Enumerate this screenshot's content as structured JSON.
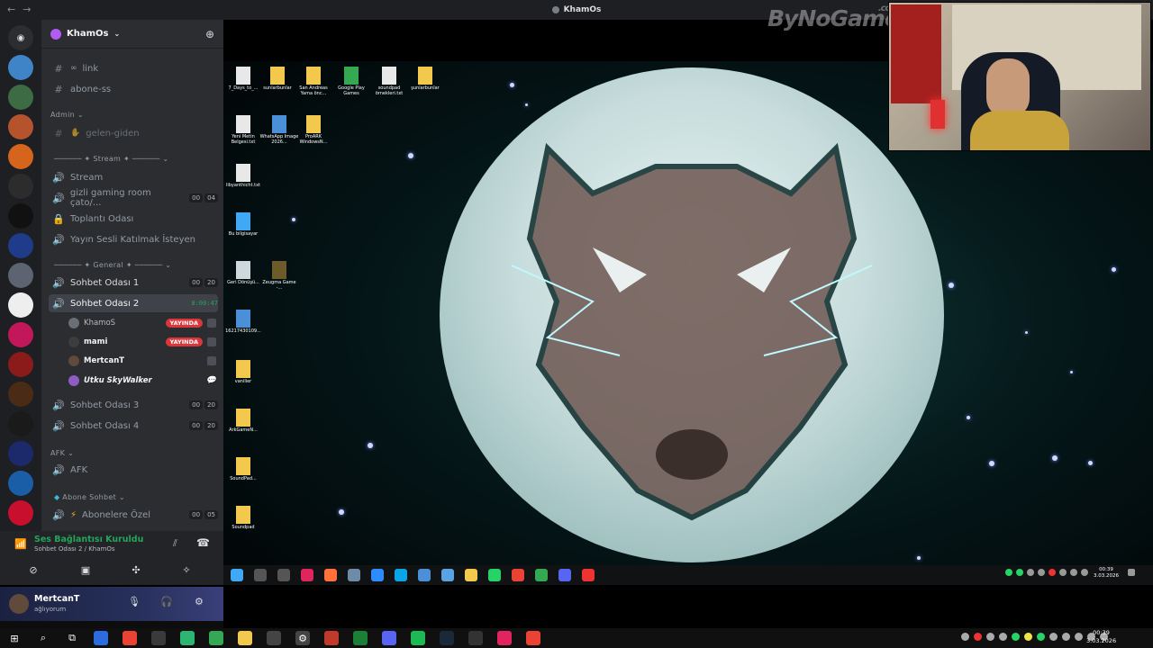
{
  "window": {
    "title": "KhamOs",
    "back_icon": "arrow-left",
    "forward_icon": "arrow-right"
  },
  "server": {
    "name": "KhamOs"
  },
  "channels": {
    "text": [
      "link",
      "abone-ss"
    ],
    "admin_category": "Admin",
    "admin_channel": "gelen-giden",
    "stream_category": "Stream",
    "stream_channels": [
      {
        "label": "Stream"
      },
      {
        "label": "gizli gaming room çato/...",
        "a": "00",
        "b": "04"
      },
      {
        "label": "Toplantı Odası"
      },
      {
        "label": "Yayın Sesli Katılmak İsteyen"
      }
    ],
    "general_category": "General",
    "general_channels": [
      {
        "label": "Sohbet Odası 1",
        "a": "00",
        "b": "20"
      },
      {
        "label": "Sohbet Odası 2",
        "timer": "8:00:47"
      },
      {
        "label": "Sohbet Odası 3",
        "a": "00",
        "b": "20"
      },
      {
        "label": "Sohbet Odası 4",
        "a": "00",
        "b": "20"
      }
    ],
    "voice_users": [
      {
        "name": "KhamoS",
        "badge": "YAYINDA"
      },
      {
        "name": "mami",
        "badge": "YAYINDA"
      },
      {
        "name": "MertcanT"
      },
      {
        "name": "Utku SkyWalker"
      }
    ],
    "afk_category": "AFK",
    "afk_channel": "AFK",
    "abone_category": "Abone Sohbet",
    "abone_channel": "Abonelere Özel",
    "abone_a": "00",
    "abone_b": "05"
  },
  "voice": {
    "status": "Ses Bağlantısı Kuruldu",
    "location": "Sohbet Odası 2 / KhamOs"
  },
  "user_panel": {
    "name": "MertcanT",
    "status": "ağlıyorum"
  },
  "stream": {
    "watermark": "ByNoGame",
    "watermark_domain": ".com",
    "desktop_icons": [
      {
        "label": "7_Days_to_..."
      },
      {
        "label": "sunlarbunlar"
      },
      {
        "label": "San Andreas Yama önc..."
      },
      {
        "label": "Google Play Games"
      },
      {
        "label": "soundpad örnekleri.txt"
      },
      {
        "label": "şunlarbunlar"
      },
      {
        "label": "Yeni Metin Belgesi.txt"
      },
      {
        "label": "WhatsApp Image 2026..."
      },
      {
        "label": "ProARK WindowsN..."
      },
      {
        "label": "libyanthicht.txt"
      },
      {
        "label": "Bu bilgisayar"
      },
      {
        "label": "Geri Dönüşü..."
      },
      {
        "label": "Zeugma Game -..."
      },
      {
        "label": "16217430109..."
      },
      {
        "label": "vanilier"
      },
      {
        "label": "ArkGameN..."
      },
      {
        "label": "SoundPad..."
      },
      {
        "label": "Soundpad"
      }
    ],
    "clock_time": "00:39",
    "clock_date": "3.03.2026"
  },
  "taskbar": {
    "time": "00:39",
    "date": "3.03.2026"
  }
}
